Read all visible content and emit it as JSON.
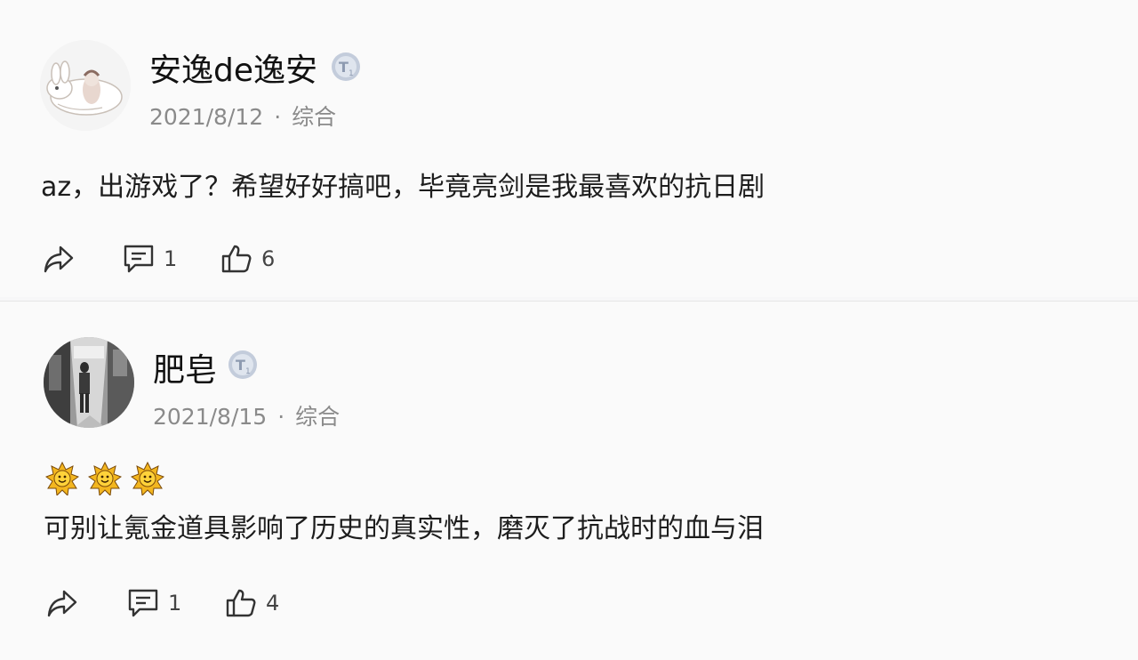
{
  "comments": [
    {
      "username": "安逸de逸安",
      "date": "2021/8/12",
      "separator": "·",
      "category": "综合",
      "content": "az，出游戏了？希望好好搞吧，毕竟亮剑是我最喜欢的抗日剧",
      "reply_count": "1",
      "like_count": "6",
      "avatar_icon": "bunny-avatar",
      "badge_icon": "level-badge-icon"
    },
    {
      "username": "肥皂",
      "date": "2021/8/15",
      "separator": "·",
      "category": "综合",
      "emojis": [
        "sun-emoji",
        "sun-emoji",
        "sun-emoji"
      ],
      "content": "可别让氪金道具影响了历史的真实性，磨灭了抗战时的血与泪",
      "reply_count": "1",
      "like_count": "4",
      "avatar_icon": "photo-avatar",
      "badge_icon": "level-badge-icon"
    }
  ],
  "colors": {
    "background": "#fafafa",
    "meta_text": "#8a8a8a",
    "body_text": "#1d1d1d",
    "badge": "#b9c4d6"
  }
}
